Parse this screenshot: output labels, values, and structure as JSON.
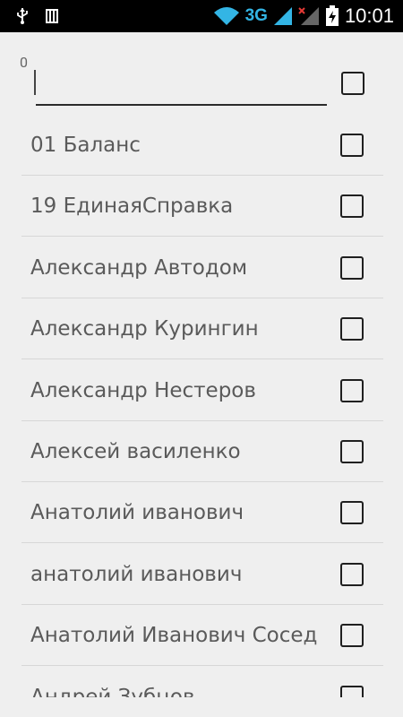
{
  "status_bar": {
    "network": "3G",
    "time": "10:01"
  },
  "search": {
    "counter": "0",
    "value": "",
    "placeholder": ""
  },
  "contacts": [
    {
      "name": "01 Баланс"
    },
    {
      "name": "19 ЕдинаяСправка"
    },
    {
      "name": "Александр Автодом"
    },
    {
      "name": "Александр Курингин"
    },
    {
      "name": "Александр Нестеров"
    },
    {
      "name": "Алексей василенко"
    },
    {
      "name": "Анатолий иванович"
    },
    {
      "name": "анатолий иванович"
    },
    {
      "name": "Анатолий Иванович Сосед"
    },
    {
      "name": "Андрей Зубцов"
    }
  ],
  "colors": {
    "accent": "#33b5e5",
    "background": "#efefef",
    "text": "#5a5a5a"
  }
}
